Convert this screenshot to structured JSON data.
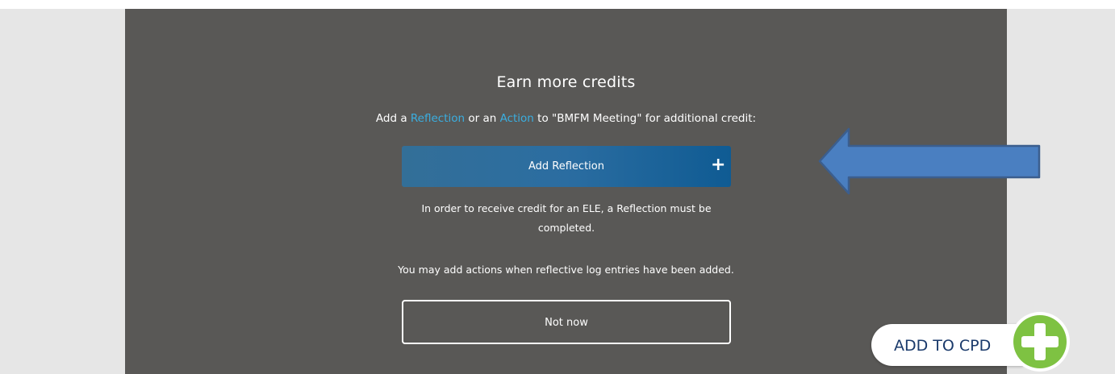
{
  "modal": {
    "title": "Earn more credits",
    "intro": {
      "prefix": "Add a ",
      "reflection_link": "Reflection",
      "middle": " or an ",
      "action_link": "Action",
      "suffix": " to \"BMFM Meeting\" for additional credit:"
    },
    "add_reflection_label": "Add Reflection",
    "add_reflection_icon": "+",
    "note": "In order to receive credit for an ELE, a Reflection must be completed.",
    "actions_note": "You may add actions when reflective log entries have been added.",
    "not_now_label": "Not now"
  },
  "cpd": {
    "label": "ADD TO CPD",
    "icon": "plus-circle-icon"
  },
  "annotation": {
    "icon": "arrow-left-icon"
  },
  "colors": {
    "panel_bg": "#595856",
    "link": "#3aaee0",
    "button_gradient_start": "#336f98",
    "button_gradient_end": "#0f5b93",
    "arrow_fill": "#4a7fc1",
    "arrow_stroke": "#3b5e8e",
    "cpd_green": "#7ec242",
    "cpd_text": "#1a3a6b"
  }
}
